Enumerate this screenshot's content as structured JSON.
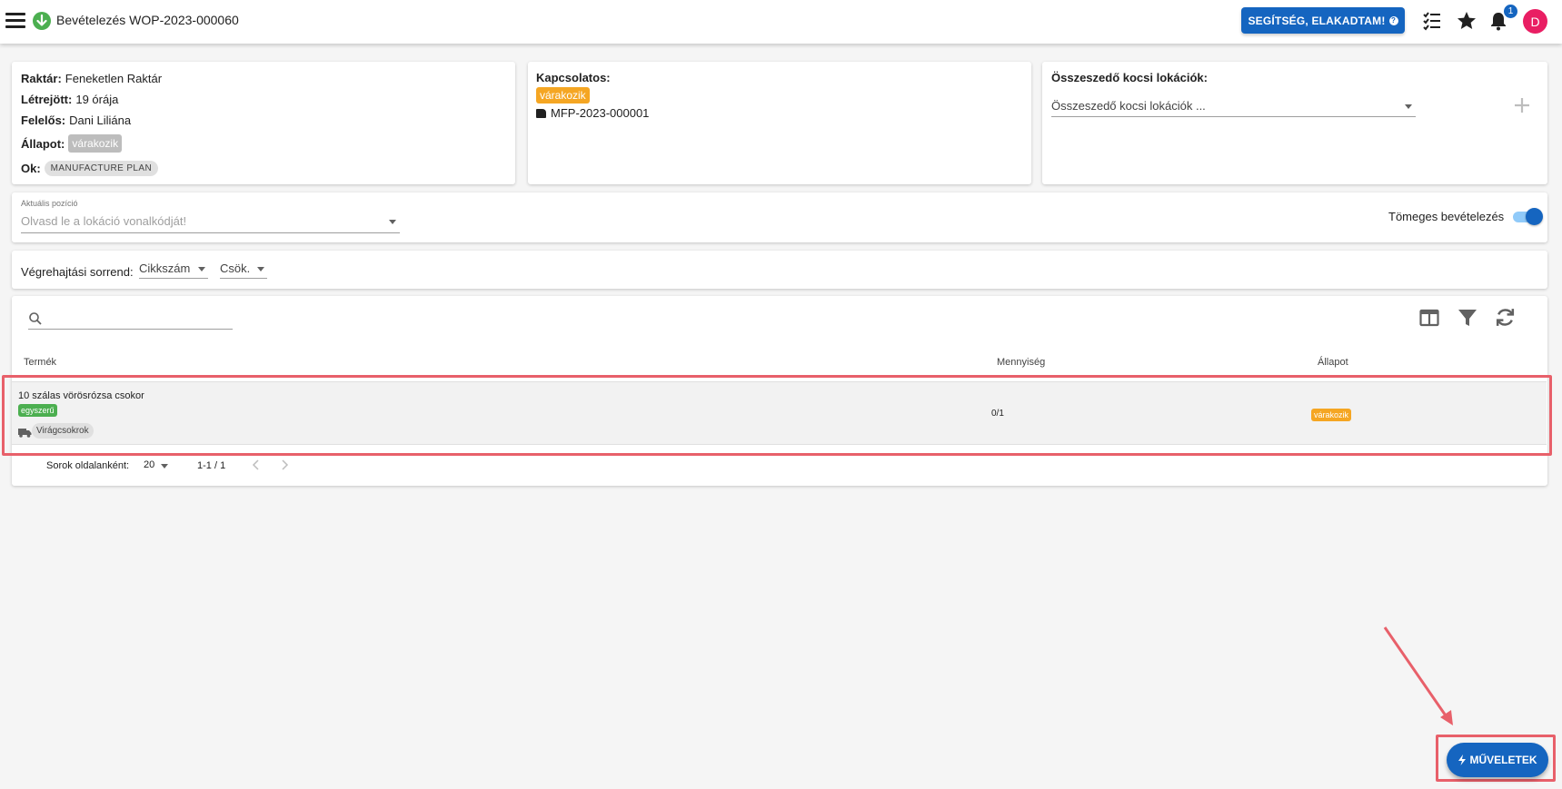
{
  "header": {
    "title": "Bevételezés WOP-2023-000060",
    "help_label": "SEGÍTSÉG, ELAKADTAM!",
    "help_icon": "?",
    "notification_count": "1",
    "avatar_letter": "D"
  },
  "info": {
    "warehouse_label": "Raktár:",
    "warehouse_value": "Feneketlen Raktár",
    "created_label": "Létrejött:",
    "created_value": "19 órája",
    "owner_label": "Felelős:",
    "owner_value": "Dani Liliána",
    "status_label": "Állapot:",
    "status_value": "várakozik",
    "reason_label": "Ok:",
    "reason_value": "MANUFACTURE PLAN"
  },
  "related": {
    "label": "Kapcsolatos:",
    "status": "várakozik",
    "doc": "MFP-2023-000001"
  },
  "cart": {
    "label": "Összeszedő kocsi lokációk:",
    "placeholder": "Összeszedő kocsi lokációk ..."
  },
  "position": {
    "label": "Aktuális pozíció",
    "placeholder": "Olvasd le a lokáció vonalkódját!",
    "bulk_label": "Tömeges bevételezés",
    "bulk_on": true
  },
  "sort": {
    "label": "Végrehajtási sorrend:",
    "field": "Cikkszám",
    "direction": "Csök."
  },
  "table": {
    "columns": [
      "Termék",
      "Mennyiség",
      "Állapot"
    ],
    "rows": [
      {
        "product": "10 szálas vörösrózsa csokor",
        "type_tag": "egyszerű",
        "category": "Virágcsokrok",
        "quantity": "0/1",
        "status": "várakozik"
      }
    ],
    "rows_per_page_label": "Sorok oldalanként:",
    "rows_per_page": "20",
    "range": "1-1 / 1"
  },
  "actions": {
    "fab_label": "MŰVELETEK"
  },
  "colors": {
    "primary": "#1565c0",
    "green": "#4caf50",
    "orange": "#f5a623",
    "highlight": "#e8606a",
    "avatar": "#e91e63"
  }
}
